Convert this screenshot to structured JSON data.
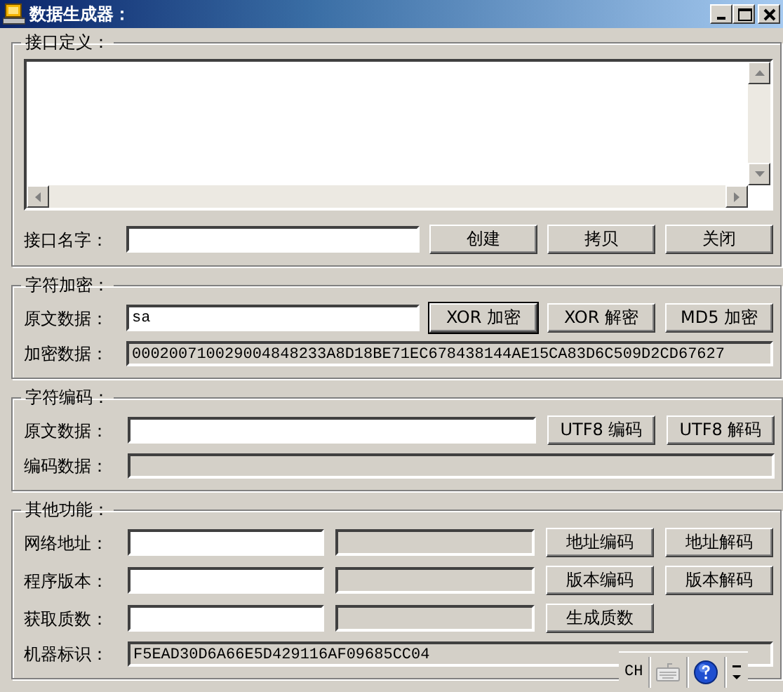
{
  "window": {
    "title": "数据生成器："
  },
  "sections": [
    {
      "kind": "definition",
      "title": "接口定义：",
      "rows": [
        {
          "items": [
            {
              "kind": "textarea"
            }
          ]
        },
        {
          "label": "接口名字：",
          "items": [
            {
              "kind": "input"
            },
            {
              "kind": "button",
              "label": "创建",
              "default": false
            },
            {
              "kind": "button",
              "label": "拷贝",
              "default": false
            },
            {
              "kind": "button",
              "label": "关闭",
              "default": false
            }
          ]
        }
      ]
    },
    {
      "kind": "encrypt",
      "title": "字符加密：",
      "rows": [
        {
          "label": "原文数据：",
          "items": [
            {
              "kind": "input",
              "value": "sa"
            },
            {
              "kind": "button",
              "label": "XOR 加密",
              "default": true
            },
            {
              "kind": "button",
              "label": "XOR 解密",
              "default": false
            },
            {
              "kind": "button",
              "label": "MD5 加密",
              "default": false
            }
          ]
        },
        {
          "label": "加密数据：",
          "items": [
            {
              "kind": "result",
              "value": "000200710029004848233A8D18BE71EC678438144AE15CA83D6C509D2CD67627"
            }
          ]
        }
      ]
    },
    {
      "kind": "encode",
      "title": "字符编码：",
      "rows": [
        {
          "label": "原文数据：",
          "items": [
            {
              "kind": "input"
            },
            {
              "kind": "button",
              "label": "UTF8 编码",
              "default": false
            },
            {
              "kind": "button",
              "label": "UTF8 解码",
              "default": false
            }
          ]
        },
        {
          "label": "编码数据：",
          "items": [
            {
              "kind": "result"
            }
          ]
        }
      ]
    },
    {
      "kind": "other",
      "title": "其他功能：",
      "rows": [
        {
          "label": "网络地址：",
          "items": [
            {
              "kind": "input"
            },
            {
              "kind": "output"
            },
            {
              "kind": "button",
              "label": "地址编码",
              "default": false
            },
            {
              "kind": "button",
              "label": "地址解码",
              "default": false
            }
          ]
        },
        {
          "label": "程序版本：",
          "items": [
            {
              "kind": "input"
            },
            {
              "kind": "output"
            },
            {
              "kind": "button",
              "label": "版本编码",
              "default": false
            },
            {
              "kind": "button",
              "label": "版本解码",
              "default": false
            }
          ]
        },
        {
          "label": "获取质数：",
          "items": [
            {
              "kind": "input"
            },
            {
              "kind": "output"
            },
            {
              "kind": "button",
              "label": "生成质数",
              "default": false
            }
          ]
        },
        {
          "label": "机器标识：",
          "items": [
            {
              "kind": "result",
              "value": "F5EAD30D6A66E5D429116AF09685CC04"
            }
          ]
        }
      ]
    }
  ],
  "language_bar": {
    "label": "CH"
  }
}
